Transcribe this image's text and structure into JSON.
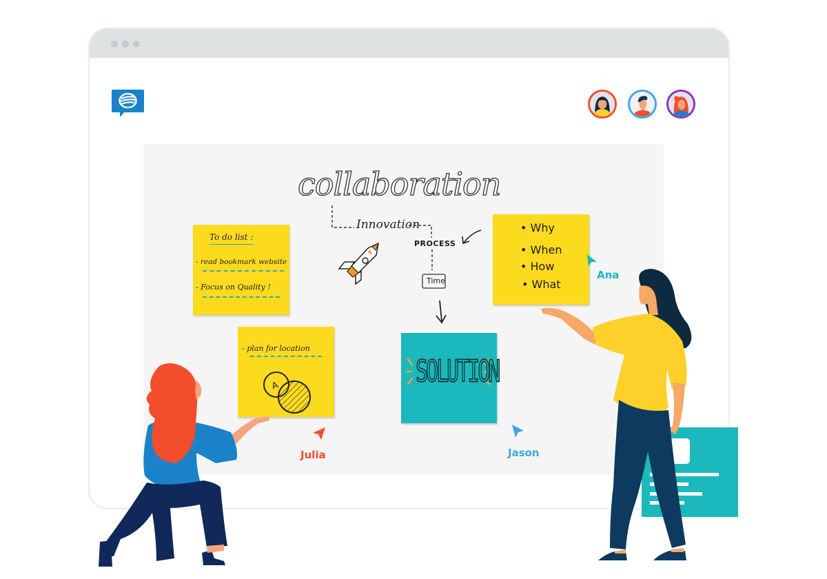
{
  "window": {
    "controls": [
      "dot-1",
      "dot-2",
      "dot-3"
    ]
  },
  "app": {
    "logo_icon": "chat-bubble-logo-icon",
    "brand_color": "#1a82c8"
  },
  "collaborators": [
    {
      "name": "Ana",
      "ring_color": "#f24e2b",
      "icon": "avatar-woman-dark-hair-icon"
    },
    {
      "name": "Jason",
      "ring_color": "#40a7e6",
      "icon": "avatar-man-icon"
    },
    {
      "name": "Julia",
      "ring_color": "#8f30c2",
      "icon": "avatar-woman-red-hair-icon"
    }
  ],
  "board": {
    "title": "collaboration",
    "mindmap": {
      "node_innovation": "Innovation",
      "node_process": "PROCESS",
      "node_time": "Time"
    },
    "notes": [
      {
        "id": "todo",
        "color": "#fcdb1f",
        "heading": "To do list :",
        "lines": [
          "- read bookmark website",
          "- Focus on Quality !"
        ]
      },
      {
        "id": "plan",
        "color": "#fcdb1f",
        "lines": [
          "- plan for location"
        ],
        "diagram_label": "A"
      },
      {
        "id": "solution",
        "color": "#1bb9bd",
        "text": "SOLUTION"
      },
      {
        "id": "questions",
        "color": "#fcdb1f",
        "items": [
          "• Why",
          "• When",
          "• How",
          "• What"
        ]
      }
    ],
    "cursors": [
      {
        "name": "Julia",
        "color": "#f24e2b"
      },
      {
        "name": "Jason",
        "color": "#40a7e6"
      },
      {
        "name": "Ana",
        "color": "#1bb9bd"
      }
    ]
  }
}
